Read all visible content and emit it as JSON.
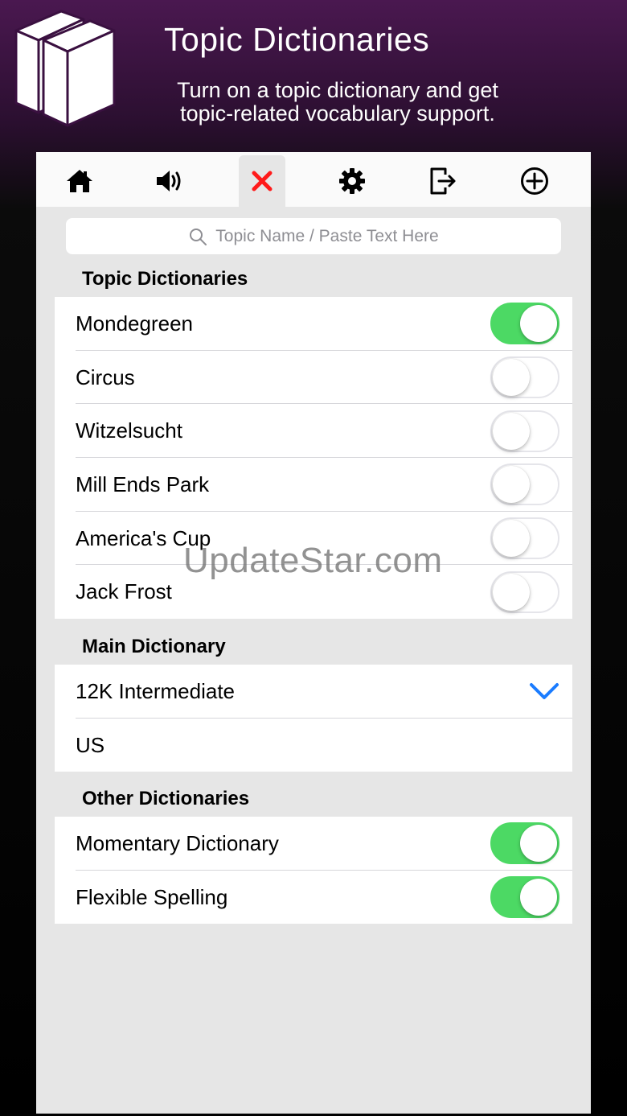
{
  "header": {
    "title": "Topic Dictionaries",
    "subtitle_line1": "Turn on a topic dictionary and get",
    "subtitle_line2": "topic-related vocabulary support.",
    "logo": "books-icon"
  },
  "toolbar": {
    "icons": [
      "home-icon",
      "speaker-icon",
      "close-icon",
      "gear-icon",
      "export-icon",
      "add-circle-icon"
    ],
    "active_index": 2,
    "close_color": "#ff1a1a"
  },
  "search": {
    "placeholder": "Topic Name / Paste Text Here",
    "icon": "search-icon"
  },
  "sections": {
    "topic": {
      "title": "Topic Dictionaries",
      "items": [
        {
          "label": "Mondegreen",
          "on": true
        },
        {
          "label": "Circus",
          "on": false
        },
        {
          "label": "Witzelsucht",
          "on": false
        },
        {
          "label": "Mill Ends Park",
          "on": false
        },
        {
          "label": "America's Cup",
          "on": false
        },
        {
          "label": "Jack Frost",
          "on": false
        }
      ]
    },
    "main": {
      "title": "Main Dictionary",
      "items": [
        {
          "label": "12K Intermediate",
          "selected": true
        },
        {
          "label": "US",
          "selected": false
        }
      ]
    },
    "other": {
      "title": "Other Dictionaries",
      "items": [
        {
          "label": "Momentary Dictionary",
          "on": true
        },
        {
          "label": "Flexible Spelling",
          "on": true
        }
      ]
    }
  },
  "colors": {
    "toggle_on": "#4cd964",
    "checkmark": "#1a7cff",
    "header_purple": "#4a1850"
  },
  "watermark": "UpdateStar.com"
}
